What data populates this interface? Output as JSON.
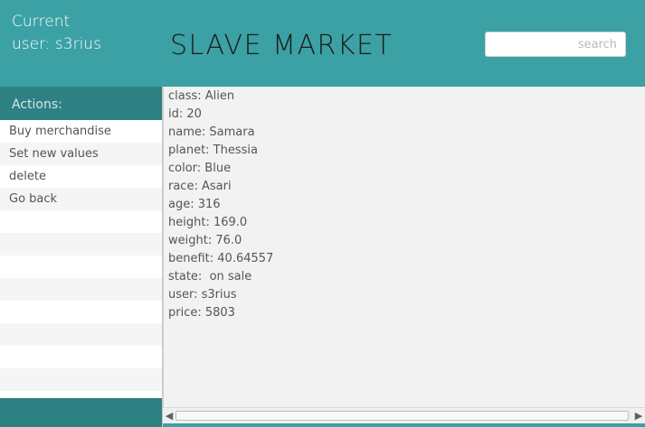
{
  "header": {
    "user_line1": "Current",
    "user_line2": "user: s3rius",
    "title": "SLAVE MARKET",
    "search_placeholder": "search",
    "search_value": ""
  },
  "sidebar": {
    "heading": "Actions:",
    "items": [
      {
        "label": "Buy merchandise"
      },
      {
        "label": "Set new values"
      },
      {
        "label": "delete"
      },
      {
        "label": "Go back"
      },
      {
        "label": ""
      },
      {
        "label": ""
      },
      {
        "label": ""
      },
      {
        "label": ""
      },
      {
        "label": ""
      },
      {
        "label": ""
      },
      {
        "label": ""
      },
      {
        "label": ""
      }
    ]
  },
  "details": [
    "class: Alien",
    "id: 20",
    "name: Samara",
    "planet: Thessia",
    "color: Blue",
    "race: Asari",
    "age: 316",
    "height: 169.0",
    "weight: 76.0",
    "benefit: 40.64557",
    "state:  on sale",
    "user: s3rius",
    "price: 5803"
  ],
  "colors": {
    "header_bg": "#3ba1a4",
    "sidebar_dark": "#2e8183",
    "content_bg": "#f2f2f2"
  },
  "icons": {
    "scroll_left": "◀",
    "scroll_right": "▶"
  }
}
